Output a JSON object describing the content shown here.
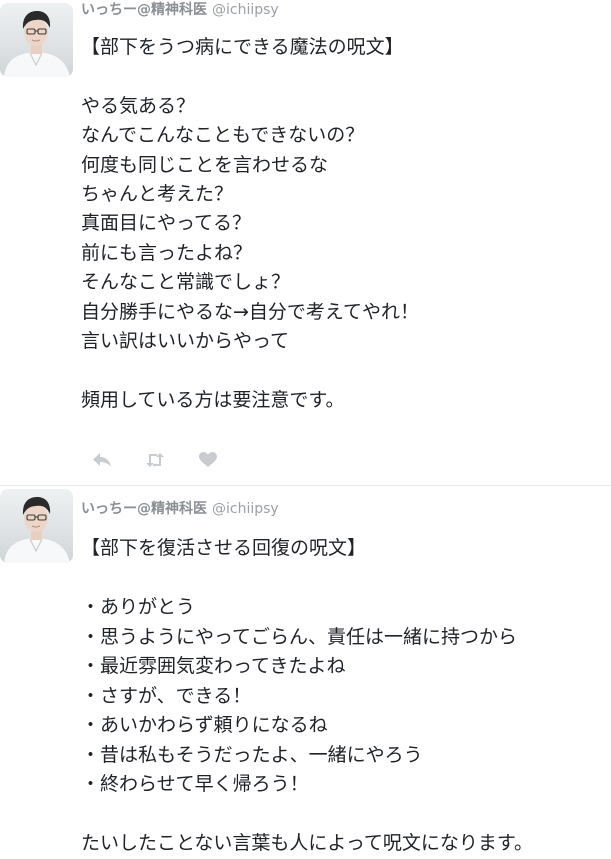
{
  "tweets": [
    {
      "author": {
        "display_name": "いっちー@精神科医",
        "handle": "@ichiipsy"
      },
      "lines": [
        "【部下をうつ病にできる魔法の呪文】",
        "",
        "やる気ある？",
        "なんでこんなこともできないの？",
        "何度も同じことを言わせるな",
        "ちゃんと考えた？",
        "真面目にやってる？",
        "前にも言ったよね？",
        "そんなこと常識でしょ？",
        "自分勝手にやるな→自分で考えてやれ！",
        "言い訳はいいからやって",
        "",
        "頻用している方は要注意です。"
      ],
      "actions": [
        "reply-icon",
        "retweet-icon",
        "like-icon"
      ]
    },
    {
      "author": {
        "display_name": "いっちー@精神科医",
        "handle": "@ichiipsy"
      },
      "lines": [
        "【部下を復活させる回復の呪文】",
        "",
        "・ありがとう",
        "・思うようにやってごらん、責任は一緒に持つから",
        "・最近雰囲気変わってきたよね",
        "・さすが、できる！",
        "・あいかわらず頼りになるね",
        "・昔は私もそうだったよ、一緒にやろう",
        "・終わらせて早く帰ろう！",
        "",
        "たいしたことない言葉も人によって呪文になります。"
      ]
    }
  ],
  "colors": {
    "text": "#1f2328",
    "name": "#8a8f94",
    "handle": "#9aa0a5",
    "action_icon": "#c7ccd1",
    "divider": "#e6ecf0"
  }
}
